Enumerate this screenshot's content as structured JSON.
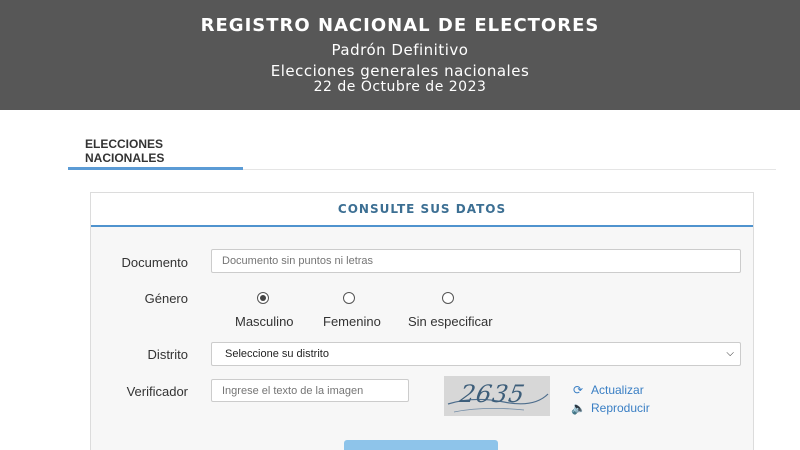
{
  "header": {
    "title": "REGISTRO NACIONAL DE ELECTORES",
    "subtitle": "Padrón Definitivo",
    "line3": "Elecciones generales nacionales",
    "date": "22 de Octubre de 2023",
    "background": "#575757"
  },
  "tabs": [
    {
      "label": "ELECCIONES NACIONALES",
      "active": true
    }
  ],
  "form": {
    "title": "CONSULTE SUS DATOS",
    "documento": {
      "label": "Documento",
      "placeholder": "Documento sin puntos ni letras"
    },
    "genero": {
      "label": "Género",
      "options": [
        {
          "label": "Masculino",
          "checked": true
        },
        {
          "label": "Femenino",
          "checked": false
        },
        {
          "label": "Sin especificar",
          "checked": false
        }
      ]
    },
    "distrito": {
      "label": "Distrito",
      "selected": "Seleccione su distrito"
    },
    "verificador": {
      "label": "Verificador",
      "placeholder": "Ingrese el texto de la imagen",
      "captcha_text": "2635",
      "actualizar": "Actualizar",
      "reproducir": "Reproducir"
    }
  },
  "colors": {
    "accent": "#4f93ce",
    "link": "#3a7fc4",
    "button": "#8ec4ea"
  }
}
